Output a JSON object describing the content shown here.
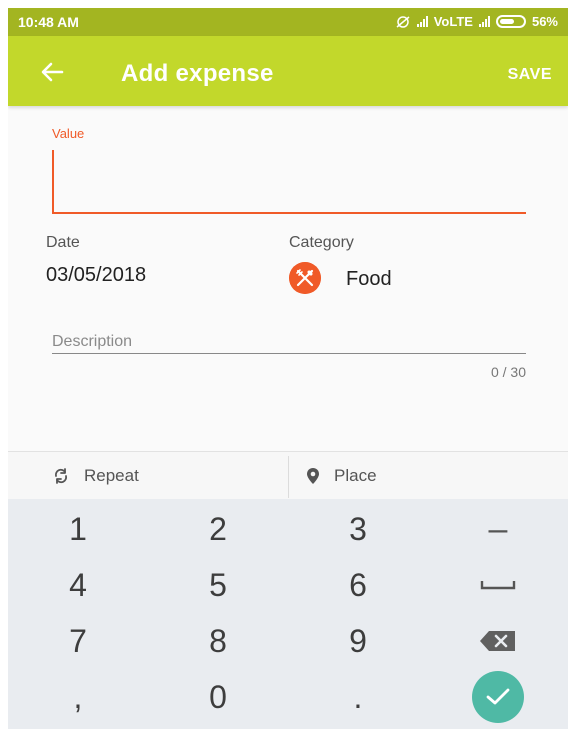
{
  "status_bar": {
    "time": "10:48 AM",
    "network": "VoLTE",
    "battery": "56%"
  },
  "app_bar": {
    "title": "Add expense",
    "save_label": "SAVE"
  },
  "form": {
    "value_label": "Value",
    "value": "",
    "date_label": "Date",
    "date_value": "03/05/2018",
    "category_label": "Category",
    "category_value": "Food",
    "category_icon": "fork-knife-icon",
    "description_placeholder": "Description",
    "description_counter": "0 / 30"
  },
  "actions": {
    "repeat_label": "Repeat",
    "place_label": "Place"
  },
  "keypad": {
    "keys": [
      "1",
      "2",
      "3",
      "–",
      "4",
      "5",
      "6",
      "space",
      "7",
      "8",
      "9",
      "backspace",
      ",",
      "0",
      ".",
      "done"
    ]
  },
  "colors": {
    "status_bar": "#a3b521",
    "app_bar": "#c2d82b",
    "accent": "#f05a28",
    "done_key": "#4fb9a5"
  }
}
